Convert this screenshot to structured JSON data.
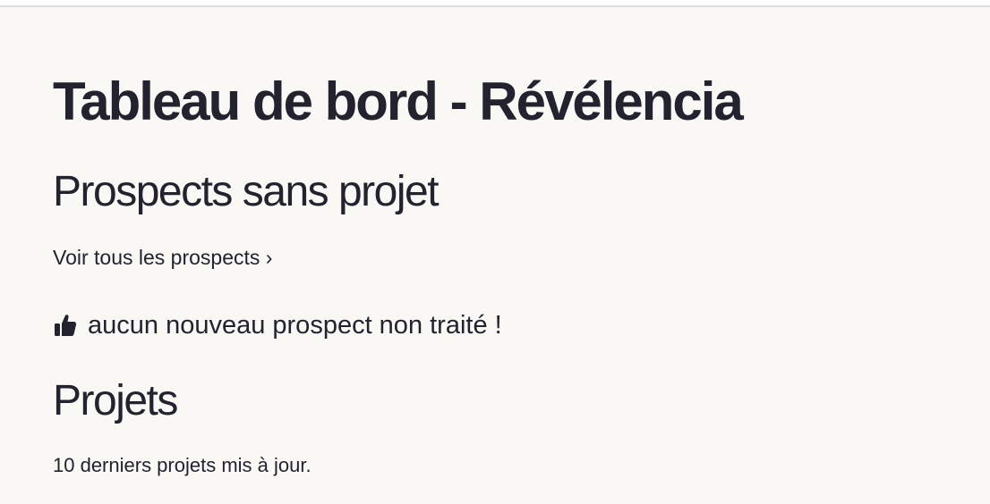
{
  "page": {
    "title": "Tableau de bord - Révélencia"
  },
  "prospects": {
    "heading": "Prospects sans projet",
    "view_all_link": "Voir tous les prospects ›",
    "empty_icon": "thumbs-up-icon",
    "empty_message": "aucun nouveau prospect non traité !"
  },
  "projects": {
    "heading": "Projets",
    "caption": "10 derniers projets mis à jour."
  },
  "colors": {
    "background": "#f9f8f5",
    "text": "#22232f"
  }
}
